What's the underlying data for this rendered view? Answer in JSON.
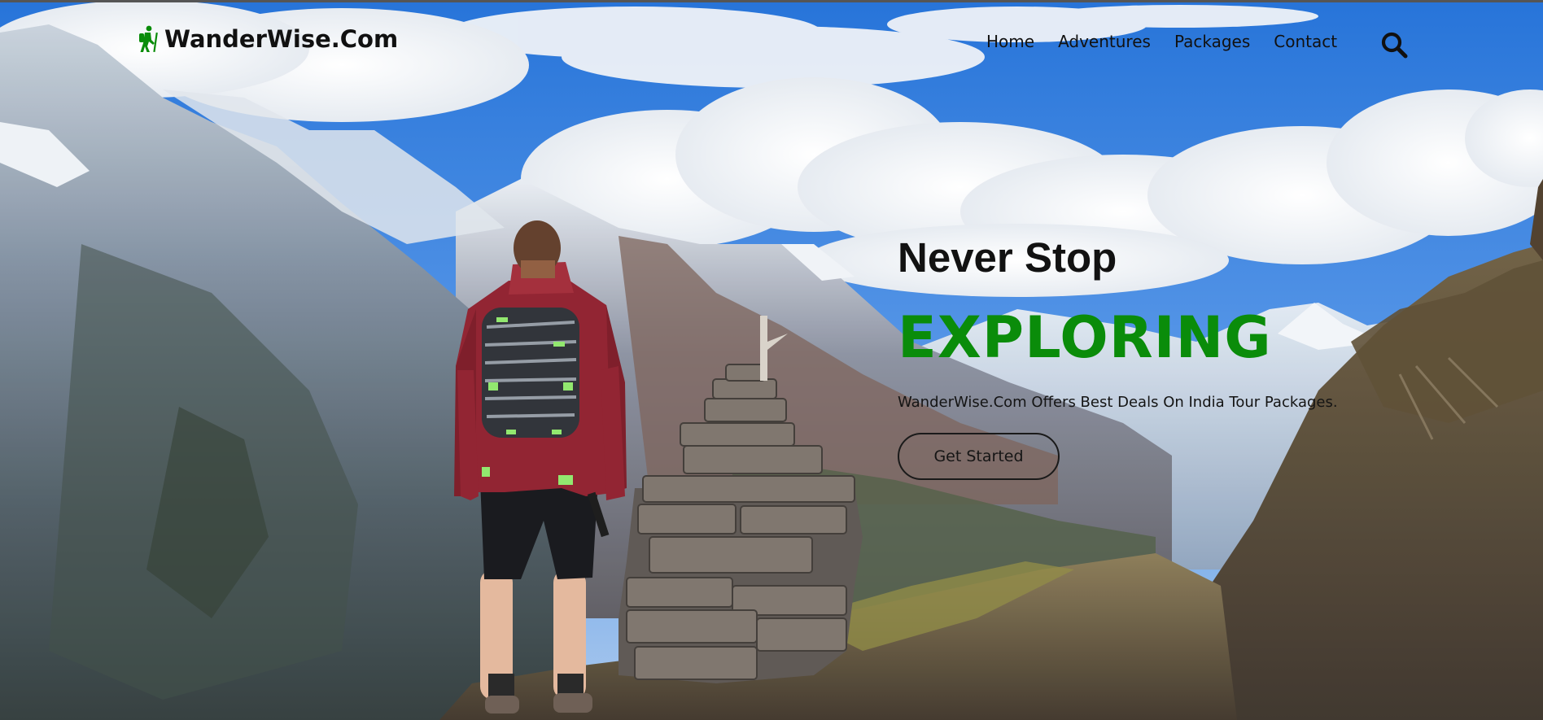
{
  "brand": {
    "name": "WanderWise.Com",
    "icon": "hiker-icon",
    "icon_color": "#0a8c0a"
  },
  "nav": {
    "items": [
      {
        "label": "Home"
      },
      {
        "label": "Adventures"
      },
      {
        "label": "Packages"
      },
      {
        "label": "Contact"
      }
    ],
    "search_icon": "search-icon"
  },
  "hero": {
    "subtitle": "Never Stop",
    "title": "EXPLORING",
    "title_color": "#0a8c0a",
    "description": "WanderWise.Com Offers Best Deals On India Tour Packages.",
    "cta_label": "Get Started"
  },
  "background": {
    "subject": "hiker-with-backpack-beside-stone-cairn-in-mountains",
    "sky_color": "#2f7fe0",
    "cloud_color": "#f2f4f7"
  }
}
